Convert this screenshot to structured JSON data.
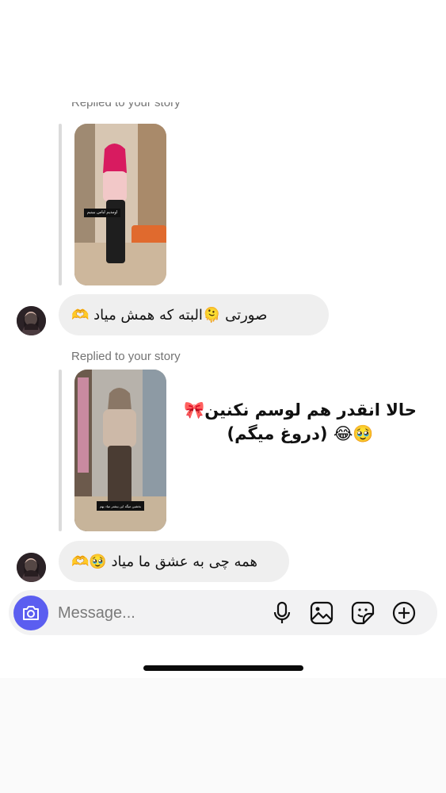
{
  "thread": {
    "messages": [
      {
        "reply_label": "Replied to your story",
        "story_caption": "اومدیم لباس ببینیم",
        "text": "صورتی 🫠البته که همش میاد 🫶"
      },
      {
        "reply_label": "Replied to your story",
        "story_caption": "بخشین میگه این بیشتر میاد بهم",
        "overlay": "حالا انقدر هم لوسم نکنین🎀🥹😂 (دروغ میگم)",
        "text": "همه چی به عشق ما میاد 🥹🫶"
      }
    ]
  },
  "composer": {
    "placeholder": "Message...",
    "icons": [
      "camera-icon",
      "microphone-icon",
      "gallery-icon",
      "sticker-icon",
      "plus-icon"
    ]
  },
  "colors": {
    "accent": "#5b5ef0",
    "bubble": "#efefef",
    "label": "#737373"
  }
}
